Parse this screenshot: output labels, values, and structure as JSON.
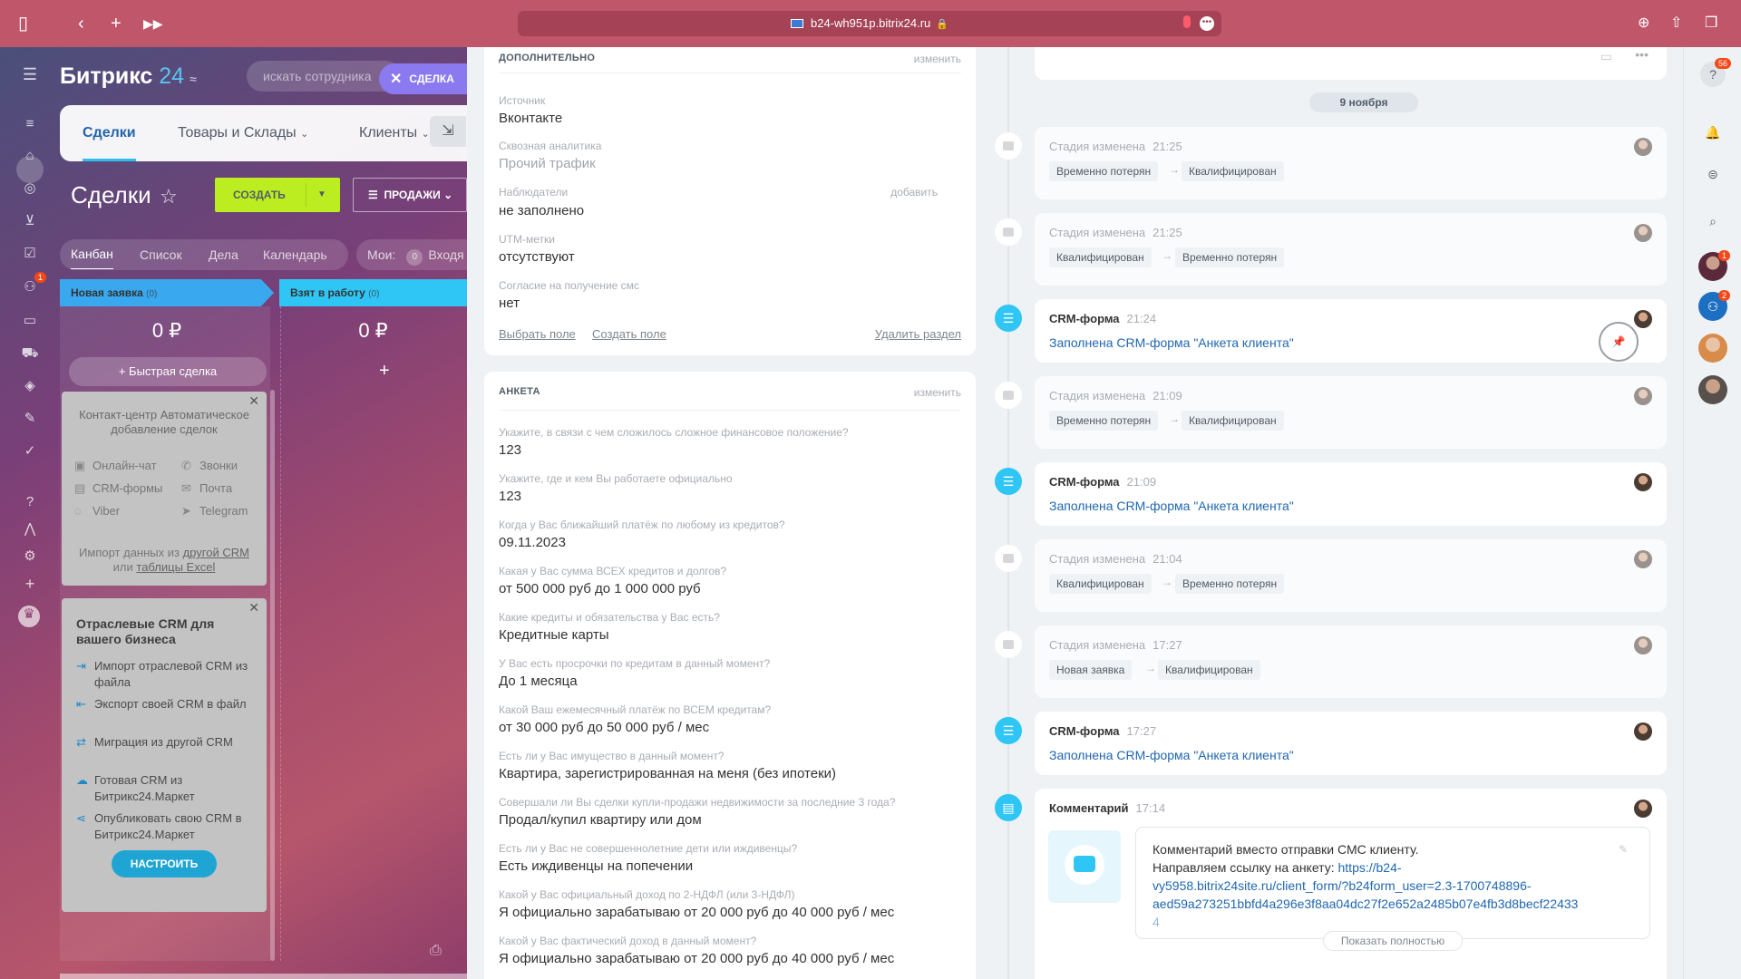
{
  "browser": {
    "url": "b24-wh951p.bitrix24.ru"
  },
  "portal": {
    "logo_main": "Битрикс",
    "logo_num": "24",
    "search_placeholder": "искать сотрудника",
    "deal_tag": "СДЕЛКА",
    "rail_badge": "1"
  },
  "nav_tabs": [
    "Сделки",
    "Товары и Склады",
    "Клиенты"
  ],
  "page": {
    "title": "Сделки",
    "create_label": "СОЗДАТЬ",
    "pipeline_label": "ПРОДАЖИ",
    "views": [
      "Канбан",
      "Список",
      "Дела",
      "Календарь"
    ],
    "mine_label": "Мои:",
    "mine_count": "0",
    "mine_more": "Входя"
  },
  "kanban": {
    "columns": [
      {
        "name": "Новая заявка",
        "count": "(0)",
        "sum": "0 ₽"
      },
      {
        "name": "Взят в работу",
        "count": "(0)",
        "sum": "0 ₽"
      }
    ],
    "quick_deal": "Быстрая сделка",
    "plus": "+"
  },
  "contact_center": {
    "title": "Контакт-центр Автоматическое добавление сделок",
    "items": [
      "Онлайн-чат",
      "Звонки",
      "CRM-формы",
      "Почта",
      "Viber",
      "Telegram"
    ],
    "import_prefix": "Импорт данных из",
    "import_link1": "другой CRM",
    "import_or": "или",
    "import_link2": "таблицы Excel"
  },
  "industry": {
    "title": "Отраслевые CRM для вашего бизнеса",
    "items": [
      "Импорт отраслевой CRM из файла",
      "Экспорт своей CRM в файл",
      "Миграция из другой CRM",
      "Готовая CRM из Битрикс24.Маркет",
      "Опубликовать свою CRM в Битрикс24.Маркет"
    ],
    "button": "НАСТРОИТЬ"
  },
  "extra_section": {
    "header": "ДОПОЛНИТЕЛЬНО",
    "edit": "изменить",
    "add": "добавить",
    "fields": [
      {
        "label": "Источник",
        "value": "Вконтакте"
      },
      {
        "label": "Сквозная аналитика",
        "value": "Прочий трафик"
      },
      {
        "label": "Наблюдатели",
        "value": "не заполнено"
      },
      {
        "label": "UTM-метки",
        "value": "отсутствуют"
      },
      {
        "label": "Согласие на получение смс",
        "value": "нет"
      }
    ],
    "choose_field": "Выбрать поле",
    "create_field": "Создать поле",
    "delete_section": "Удалить раздел"
  },
  "survey_section": {
    "header": "АНКЕТА",
    "edit": "изменить",
    "fields": [
      {
        "label": "Укажите, в связи с чем сложилось сложное финансовое положение?",
        "value": "123"
      },
      {
        "label": "Укажите, где и кем Вы работаете официально",
        "value": "123"
      },
      {
        "label": "Когда у Вас ближайший платёж по любому из кредитов?",
        "value": "09.11.2023"
      },
      {
        "label": "Какая у Вас сумма ВСЕХ кредитов и долгов?",
        "value": "от 500 000 руб до 1 000 000 руб"
      },
      {
        "label": "Какие кредиты и обязательства у Вас есть?",
        "value": "Кредитные карты"
      },
      {
        "label": "У Вас есть просрочки по кредитам в данный момент?",
        "value": "До 1 месяца"
      },
      {
        "label": "Какой Ваш ежемесячный платёж по ВСЕМ кредитам?",
        "value": "от 30 000 руб до 50 000 руб / мес"
      },
      {
        "label": "Есть ли у Вас имущество в данный момент?",
        "value": "Квартира, зарегистрированная на меня (без ипотеки)"
      },
      {
        "label": "Совершали ли Вы сделки купли-продажи недвижимости за последние 3 года?",
        "value": "Продал/купил квартиру или дом"
      },
      {
        "label": "Есть ли у Вас не совершеннолетние дети или иждивенцы?",
        "value": "Есть иждивенцы на попечении"
      },
      {
        "label": "Какой у Вас официальный доход по 2-НДФЛ (или 3-НДФЛ)",
        "value": "Я официально зарабатываю от 20 000 руб до 40 000 руб / мес"
      },
      {
        "label": "Какой у Вас фактический доход в данный момент?",
        "value": "Я официально зарабатываю от 20 000 руб до 40 000 руб / мес"
      }
    ]
  },
  "timeline": {
    "date": "9 ноября",
    "events": [
      {
        "type": "stage",
        "title": "Стадия изменена",
        "time": "21:25",
        "from": "Временно потерян",
        "to": "Квалифицирован"
      },
      {
        "type": "stage",
        "title": "Стадия изменена",
        "time": "21:25",
        "from": "Квалифицирован",
        "to": "Временно потерян"
      },
      {
        "type": "form",
        "title": "CRM-форма",
        "time": "21:24",
        "text": "Заполнена CRM-форма \"Анкета клиента\""
      },
      {
        "type": "stage",
        "title": "Стадия изменена",
        "time": "21:09",
        "from": "Временно потерян",
        "to": "Квалифицирован"
      },
      {
        "type": "form",
        "title": "CRM-форма",
        "time": "21:09",
        "text": "Заполнена CRM-форма \"Анкета клиента\""
      },
      {
        "type": "stage",
        "title": "Стадия изменена",
        "time": "21:04",
        "from": "Квалифицирован",
        "to": "Временно потерян"
      },
      {
        "type": "stage",
        "title": "Стадия изменена",
        "time": "17:27",
        "from": "Новая заявка",
        "to": "Квалифицирован"
      },
      {
        "type": "form",
        "title": "CRM-форма",
        "time": "17:27",
        "text": "Заполнена CRM-форма \"Анкета клиента\""
      }
    ],
    "comment": {
      "title": "Комментарий",
      "time": "17:14",
      "line1": "Комментарий вместо отправки СМС клиенту.",
      "line2_prefix": "Направляем ссылку на анкету:",
      "link_part1": "https://b24-",
      "link_part2": "vy5958.bitrix24site.ru/client_form/?b24form_user=2.3-1700748896-",
      "link_part3": "aed59a273251bbfd4a296e3f8aa04dc27f2e652a2485b07e4fb3d8becf22433",
      "link_part4": "4",
      "show_full": "Показать полностью"
    }
  },
  "right_bar": {
    "help_badge": "56",
    "avatar1_badge": "1",
    "avatar2_badge": "2"
  },
  "colors": {
    "browser_bar": "#c0566a",
    "accent_blue": "#2fc6f6",
    "link_blue": "#2067b0",
    "create_green": "#bbed21"
  }
}
